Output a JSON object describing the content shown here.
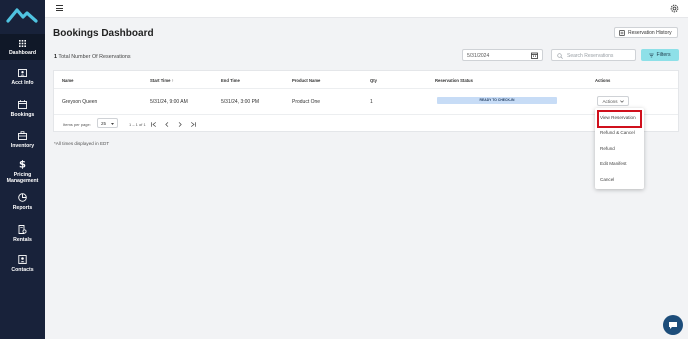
{
  "sidebar": {
    "items": [
      {
        "label": "Dashboard",
        "icon": "grid-icon"
      },
      {
        "label": "Acct Info",
        "icon": "id-card-icon"
      },
      {
        "label": "Bookings",
        "icon": "calendar-icon"
      },
      {
        "label": "Inventory",
        "icon": "briefcase-icon"
      },
      {
        "label": "Pricing",
        "label2": "Management",
        "icon": "dollar-icon"
      },
      {
        "label": "Reports",
        "icon": "pie-chart-icon"
      },
      {
        "label": "Rentals",
        "icon": "rental-icon"
      },
      {
        "label": "Contacts",
        "icon": "contacts-icon"
      }
    ]
  },
  "page": {
    "title": "Bookings Dashboard",
    "reservation_history": "Reservation History",
    "total_count": "1",
    "total_label": "Total Number Of Reservations",
    "date_value": "5/31/2024",
    "search_placeholder": "Search Reservations",
    "filters_label": "Filters",
    "note": "*All times displayed in EDT"
  },
  "table": {
    "headers": [
      "Name",
      "Start Time",
      "End Time",
      "Product Name",
      "Qty",
      "Reservation Status",
      "Actions"
    ],
    "sort_indicator": "↑",
    "rows": [
      {
        "name": "Greyson Queen",
        "start": "5/31/24, 9:00 AM",
        "end": "5/31/24, 3:00 PM",
        "product": "Product One",
        "qty": "1",
        "status": "READY TO CHECK-IN",
        "actions": "Actions"
      }
    ],
    "pager": {
      "items_label": "Items per page:",
      "per_page": "25",
      "range": "1 – 1 of 1"
    }
  },
  "dropdown": {
    "items": [
      "View Reservation",
      "Refund & Cancel",
      "Refund",
      "Edit Manifest",
      "Cancel"
    ]
  },
  "colors": {
    "sidebar": "#18223a",
    "accent": "#8ee0e8",
    "badge": "#c7dcf6",
    "highlight": "#d0101c"
  }
}
